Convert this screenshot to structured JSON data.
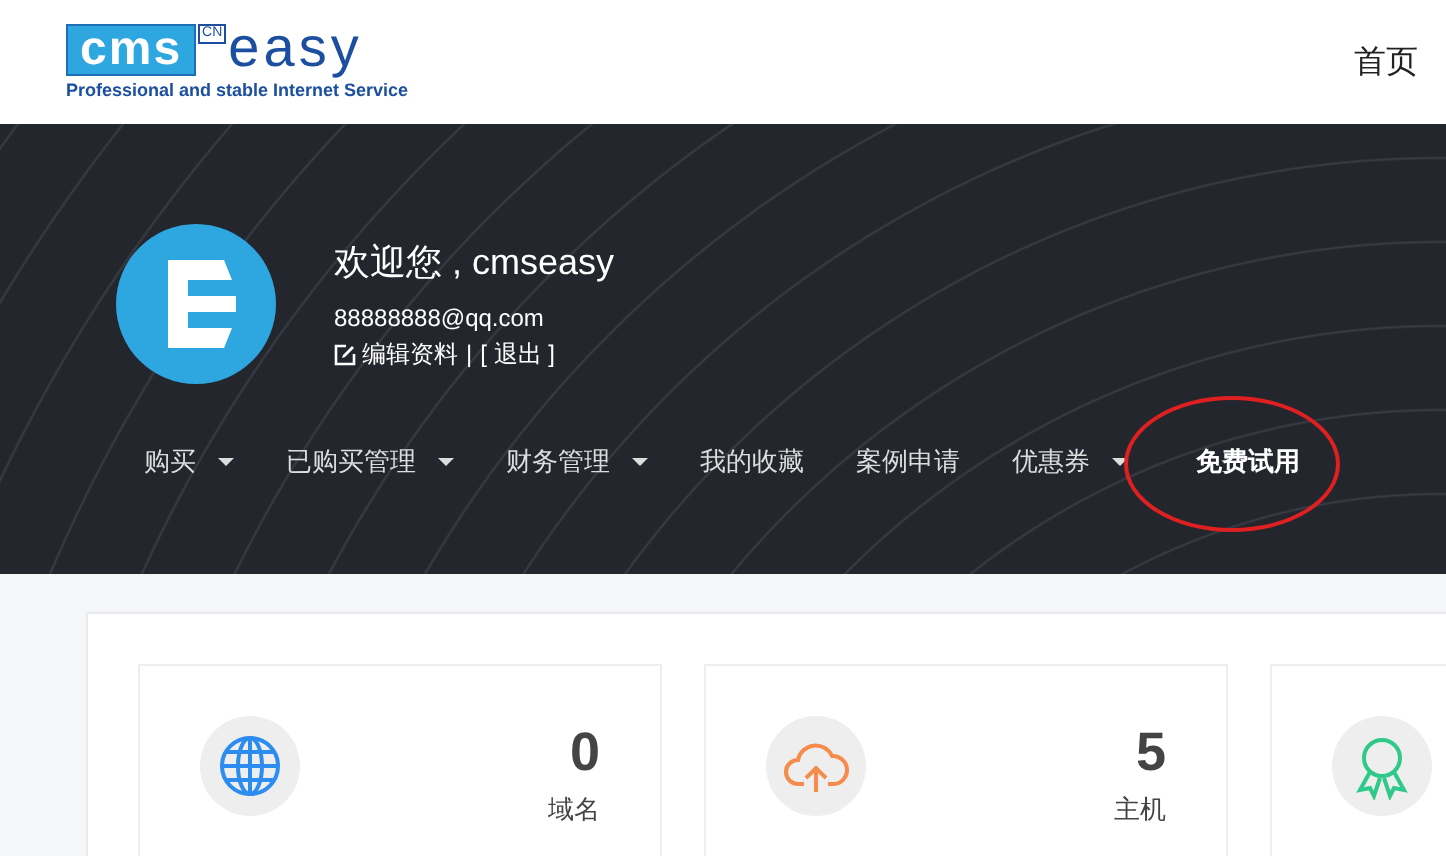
{
  "header": {
    "logo": {
      "mark": "cms",
      "badge": "CN",
      "word": "easy",
      "tagline": "Professional and stable Internet Service"
    },
    "home_link": "首页"
  },
  "profile": {
    "greeting": "欢迎您 , cmseasy",
    "email": "88888888@qq.com",
    "edit_link": "编辑资料",
    "separator": "|",
    "logout_link": "[ 退出 ]"
  },
  "nav": [
    {
      "label": "购买",
      "dropdown": true,
      "selected": false
    },
    {
      "label": "已购买管理",
      "dropdown": true,
      "selected": false
    },
    {
      "label": "财务管理",
      "dropdown": true,
      "selected": false
    },
    {
      "label": "我的收藏",
      "dropdown": false,
      "selected": false
    },
    {
      "label": "案例申请",
      "dropdown": false,
      "selected": false
    },
    {
      "label": "优惠券",
      "dropdown": true,
      "selected": false
    },
    {
      "label": "免费试用",
      "dropdown": false,
      "selected": true
    }
  ],
  "stats": [
    {
      "kind": "domain",
      "count": "0",
      "label": "域名"
    },
    {
      "kind": "host",
      "count": "5",
      "label": "主机"
    },
    {
      "kind": "award"
    }
  ]
}
